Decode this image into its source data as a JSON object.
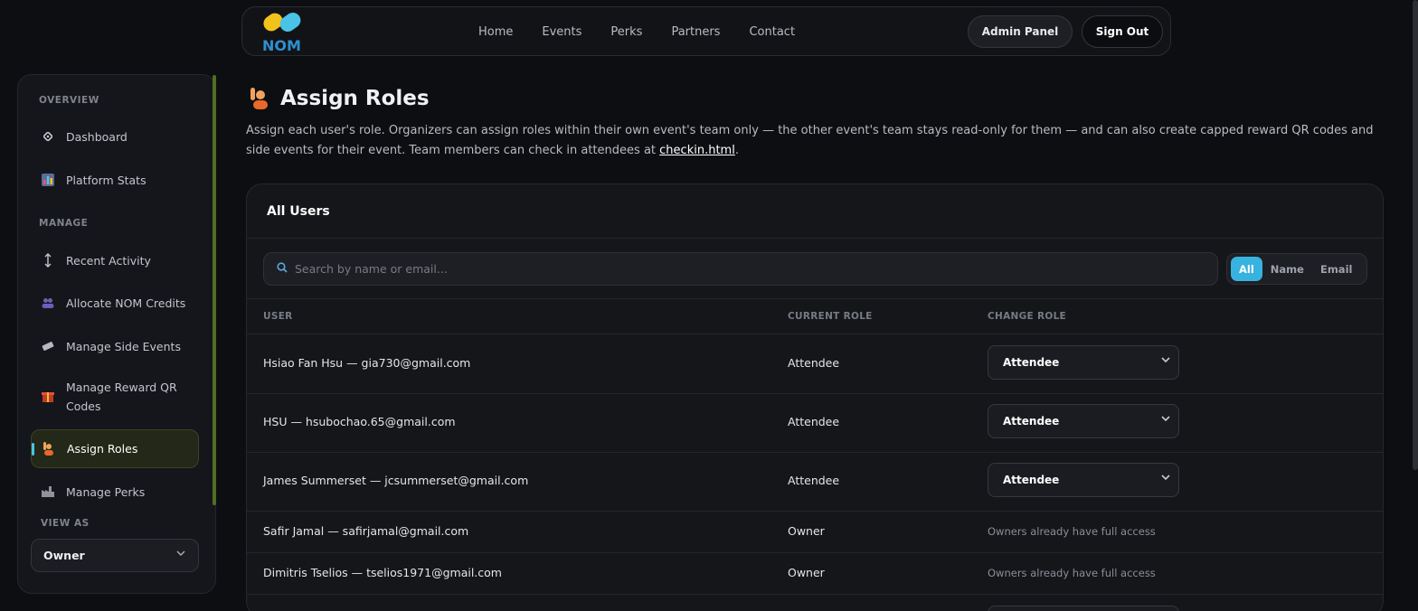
{
  "nav": {
    "logo_text": "NOM",
    "links": [
      "Home",
      "Events",
      "Perks",
      "Partners",
      "Contact"
    ],
    "admin_label": "Admin Panel",
    "signout_label": "Sign Out"
  },
  "sidebar": {
    "overview_head": "OVERVIEW",
    "manage_head": "MANAGE",
    "viewas_head": "VIEW AS",
    "items": [
      {
        "label": "Dashboard",
        "icon": "diamond-icon"
      },
      {
        "label": "Platform Stats",
        "icon": "bar-chart-icon"
      },
      {
        "label": "Recent Activity",
        "icon": "up-down-arrow-icon"
      },
      {
        "label": "Allocate NOM Credits",
        "icon": "people-icon"
      },
      {
        "label": "Manage Side Events",
        "icon": "ticket-icon"
      },
      {
        "label": "Manage Reward QR Codes",
        "icon": "gift-icon"
      },
      {
        "label": "Assign Roles",
        "icon": "raised-hand-person-icon"
      },
      {
        "label": "Manage Perks",
        "icon": "factory-icon"
      }
    ],
    "viewas_value": "Owner"
  },
  "main": {
    "title": "Assign Roles",
    "description": "Assign each user's role. Organizers can assign roles within their own event's team only — the other event's team stays read-only for them — and can also create capped reward QR codes and side events for their event. Team members can check in attendees at ",
    "description_link": "checkin.html",
    "description_end": ".",
    "card_title": "All Users",
    "search_placeholder": "Search by name or email...",
    "filters": [
      "All",
      "Name",
      "Email"
    ],
    "active_filter": "All",
    "columns": [
      "USER",
      "CURRENT ROLE",
      "CHANGE ROLE"
    ],
    "rows": [
      {
        "user": "Hsiao Fan Hsu — gia730@gmail.com",
        "role": "Attendee",
        "change": "Attendee"
      },
      {
        "user": "HSU — hsubochao.65@gmail.com",
        "role": "Attendee",
        "change": "Attendee"
      },
      {
        "user": "James Summerset — jcsummerset@gmail.com",
        "role": "Attendee",
        "change": "Attendee"
      },
      {
        "user": "Safir Jamal — safirjamal@gmail.com",
        "role": "Owner",
        "note": "Owners already have full access"
      },
      {
        "user": "Dimitris Tselios — tselios1971@gmail.com",
        "role": "Owner",
        "note": "Owners already have full access"
      }
    ]
  },
  "colors": {
    "accent": "#38b2df",
    "active_bg": "#232818",
    "background": "#0d0e11"
  }
}
